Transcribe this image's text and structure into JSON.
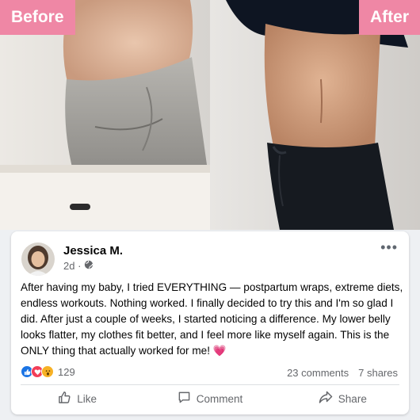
{
  "labels": {
    "before": "Before",
    "after": "After"
  },
  "post": {
    "author": "Jessica M.",
    "time": "2d ·",
    "more": "•••",
    "text": "After having my baby, I tried EVERYTHING — postpartum wraps, extreme diets, endless workouts. Nothing worked. I finally decided to try this and I'm so glad I did. After just a couple of weeks, I started noticing a difference. My lower belly looks flatter, my clothes fit better, and I feel more like myself again. This is the ONLY thing that actually worked for me! 💗",
    "reaction_count": "129",
    "comments": "23 comments",
    "shares": "7 shares"
  },
  "actions": {
    "like": "Like",
    "comment": "Comment",
    "share": "Share"
  },
  "icons": [
    "globe-icon",
    "like-reaction-icon",
    "love-reaction-icon",
    "wow-reaction-icon",
    "like-icon",
    "comment-icon",
    "share-icon",
    "more-icon"
  ],
  "colors": {
    "tag": "#ef87a5",
    "like": "#1b74e4",
    "love": "#f33e58",
    "wow": "#f7b125",
    "muted": "#65676b"
  }
}
